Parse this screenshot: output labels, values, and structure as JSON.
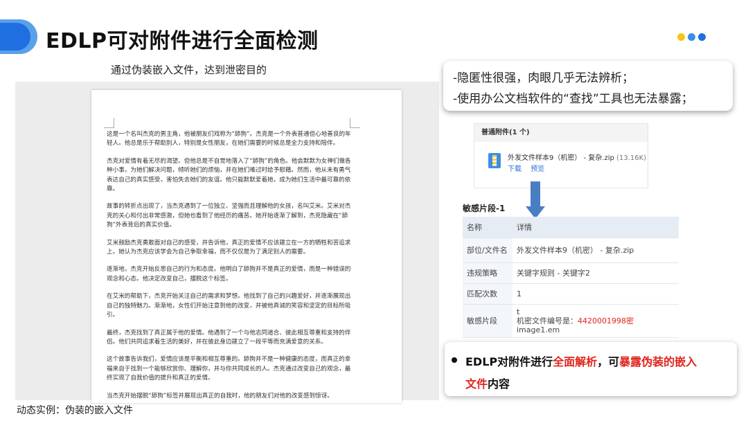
{
  "header": {
    "title": "EDLP可对附件进行全面检测",
    "dot_colors": [
      "#f5c518",
      "#3a8ee6",
      "#1f6fe0"
    ]
  },
  "subtitle": "通过伪装嵌入文件，达到泄密目的",
  "document": {
    "paragraphs": [
      "这是一个名叫杰克的男主角，他被朋友们戏称为“舔狗”。杰克是一个外表普通但心地善良的年轻人。他总是乐于帮助别人，特别是女性朋友，在她们需要的时候总是全力支持和陪伴。",
      "杰克对爱情有着无尽的渴望。但他总是不自觉地落入了“舔狗”的角色。他会默默为女神们做各种小事，为她们解决问题，倾听她们的烦恼，并在她们难过时给予慰藉。然而，他从未有勇气表达自己的真实感受，害怕失去她们的友谊。他只能默默爱着她，成为她们生活中最可靠的依靠。",
      "故事的转折点出现了，当杰克遇到了一位独立、坚强而且理解他的女孩，名叫艾米。艾米对杰克的关心和付出非常感激，但她也看到了他经历的痛苦。她开始逐渐了解到，杰克隐藏在“舔狗”外表背后的真实价值。",
      "艾米鼓励杰克勇敢面对自己的感受，并告诉他，真正的爱情不应该建立在一方的牺牲和苦追求上。她认为杰克应该学会为自己争取幸福，而不仅仅是为了满足别人的需要。",
      "逐渐地，杰克开始反思自己的行为和态度。他明白了舔狗并不是真正的爱情，而是一种错误的观念和心态。他决定改变自己，摆脱这个标签。",
      "在艾米的帮助下，杰克开始关注自己的需求和梦想。他找到了自己的兴趣爱好，并逐渐展现出自己的独特魅力。渐渐地，女性们开始注意到他的改变，并被他真诚的笑容和坚定的目标所吸引。",
      "最终，杰克找到了真正属于他的爱情。他遇到了一个与他志同道合、彼此相互尊重和支持的伴侣。他们共同追求着生活的美好，并在彼此身边建立了一段平等而充满爱意的关系。",
      "这个故事告诉我们，爱情应该是平衡和相互尊重的。舔狗并不是一种健康的态度，而真正的幸福来自于找到一个能够欣赏你、理解你，并与你共同成长的人。杰克通过改变自己的观念，最终实现了自我价值的提升和真正的爱情。",
      "当杰克开始摆脱“舔狗”标签并展现出真正的自我时，他的朋友们对他的改变感到惊讶。"
    ]
  },
  "caption": "动态实例：伪装的嵌入文件",
  "callout": {
    "line1": "-隐匿性很强，肉眼几乎无法辨析；",
    "line2": "-使用办公文档软件的“查找”工具也无法暴露；"
  },
  "attachment": {
    "header": "普通附件(1 个)",
    "icon": "zip-file-icon",
    "file_name": "外发文件样本9（机密） - 复杂.zip",
    "file_size": "(13.16K)",
    "download": "下载",
    "preview": "预览"
  },
  "sensitive": {
    "label": "敏感片段-1",
    "header": {
      "key": "名称",
      "value": "详情"
    },
    "rows": [
      {
        "key": "部位/文件名",
        "value": "外发文件样本9（机密） - 复杂.zip"
      },
      {
        "key": "违规策略",
        "value": "关键字规则 - 关键字2"
      },
      {
        "key": "匹配次数",
        "value": "1"
      }
    ],
    "fragment": {
      "key": "敏感片段",
      "line1": "t",
      "line2_prefix": "机密文件编号是：",
      "line2_highlight": "4420001998密",
      "line3": "image1.em"
    }
  },
  "bottom": {
    "part1": "EDLP对附件进行",
    "part2": "全面解析",
    "part3": "，可",
    "part4": "暴露伪装的嵌入",
    "part5": "文件",
    "part6": "内容"
  }
}
